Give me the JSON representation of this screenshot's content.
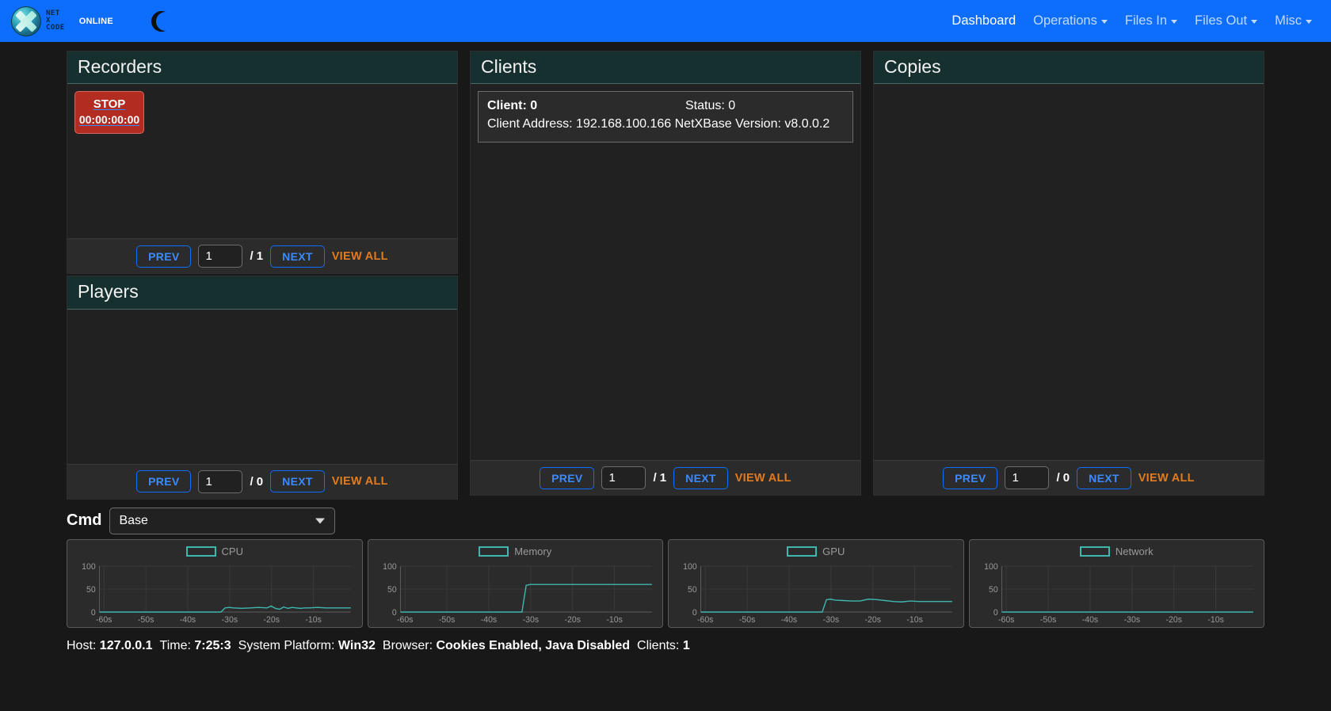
{
  "navbar": {
    "brand_lines": [
      "NET",
      "X",
      "CODE"
    ],
    "status_label": "ONLINE",
    "theme_toggle_icon": "moon-icon",
    "links": [
      {
        "label": "Dashboard",
        "has_caret": false,
        "active": true
      },
      {
        "label": "Operations",
        "has_caret": true,
        "active": false
      },
      {
        "label": "Files In",
        "has_caret": true,
        "active": false
      },
      {
        "label": "Files Out",
        "has_caret": true,
        "active": false
      },
      {
        "label": "Misc",
        "has_caret": true,
        "active": false
      }
    ],
    "brand_color": "#0d6efd"
  },
  "panels": {
    "recorders": {
      "title": "Recorders",
      "recorder": {
        "label": "STOP",
        "timecode": "00:00:00:00"
      },
      "pager": {
        "prev": "PREV",
        "page_value": "1",
        "separator": "/ 1",
        "next": "NEXT",
        "view_all": "VIEW ALL"
      }
    },
    "players": {
      "title": "Players",
      "pager": {
        "prev": "PREV",
        "page_value": "1",
        "separator": "/ 0",
        "next": "NEXT",
        "view_all": "VIEW ALL"
      }
    },
    "clients": {
      "title": "Clients",
      "card": {
        "client_label": "Client: 0",
        "status_label": "Status: 0",
        "address_line": "Client Address: 192.168.100.166 NetXBase Version: v8.0.0.2"
      },
      "pager": {
        "prev": "PREV",
        "page_value": "1",
        "separator": "/ 1",
        "next": "NEXT",
        "view_all": "VIEW ALL"
      }
    },
    "copies": {
      "title": "Copies",
      "pager": {
        "prev": "PREV",
        "page_value": "1",
        "separator": "/ 0",
        "next": "NEXT",
        "view_all": "VIEW ALL"
      }
    }
  },
  "cmd": {
    "label": "Cmd",
    "selected": "Base",
    "options": [
      "Base"
    ]
  },
  "chart_data": [
    {
      "type": "line",
      "title": "CPU",
      "xlabel": "",
      "ylabel": "",
      "ylim": [
        0,
        100
      ],
      "yticks": [
        0,
        50,
        100
      ],
      "xticks": [
        "-60s",
        "-50s",
        "-40s",
        "-30s",
        "-20s",
        "-10s"
      ],
      "grid": true,
      "legend_position": "top-center",
      "line_color": "#3fb6ae",
      "x": [
        -60,
        -58,
        -56,
        -54,
        -52,
        -50,
        -48,
        -46,
        -44,
        -42,
        -40,
        -38,
        -36,
        -34,
        -32,
        -31,
        -30,
        -29,
        -28,
        -26,
        -24,
        -22,
        -20,
        -19,
        -18,
        -17,
        -16,
        -15,
        -14,
        -13,
        -12,
        -11,
        -10,
        -8,
        -6,
        -4,
        -2,
        0
      ],
      "values": [
        0,
        0,
        0,
        0,
        0,
        0,
        0,
        0,
        0,
        0,
        0,
        0,
        0,
        0,
        0,
        0,
        9,
        10,
        9,
        8,
        9,
        10,
        9,
        13,
        8,
        6,
        11,
        8,
        10,
        9,
        8,
        9,
        9,
        10,
        9,
        9,
        9,
        9
      ]
    },
    {
      "type": "line",
      "title": "Memory",
      "xlabel": "",
      "ylabel": "",
      "ylim": [
        0,
        100
      ],
      "yticks": [
        0,
        50,
        100
      ],
      "xticks": [
        "-60s",
        "-50s",
        "-40s",
        "-30s",
        "-20s",
        "-10s"
      ],
      "grid": true,
      "legend_position": "top-center",
      "line_color": "#3fb6ae",
      "x": [
        -60,
        -56,
        -52,
        -48,
        -44,
        -40,
        -36,
        -34,
        -32,
        -31,
        -30,
        -29,
        -28,
        -26,
        -24,
        -20,
        -16,
        -12,
        -8,
        -4,
        0
      ],
      "values": [
        0,
        0,
        0,
        0,
        0,
        0,
        0,
        0,
        0,
        0,
        58,
        60,
        60,
        60,
        60,
        60,
        60,
        60,
        60,
        60,
        60
      ]
    },
    {
      "type": "line",
      "title": "GPU",
      "xlabel": "",
      "ylabel": "",
      "ylim": [
        0,
        100
      ],
      "yticks": [
        0,
        50,
        100
      ],
      "xticks": [
        "-60s",
        "-50s",
        "-40s",
        "-30s",
        "-20s",
        "-10s"
      ],
      "grid": true,
      "legend_position": "top-center",
      "line_color": "#3fb6ae",
      "x": [
        -60,
        -56,
        -52,
        -48,
        -44,
        -40,
        -36,
        -34,
        -32,
        -31,
        -30,
        -29,
        -28,
        -26,
        -24,
        -22,
        -20,
        -18,
        -16,
        -14,
        -12,
        -10,
        -8,
        -6,
        -4,
        -2,
        0
      ],
      "values": [
        0,
        0,
        0,
        0,
        0,
        0,
        0,
        0,
        0,
        0,
        27,
        28,
        26,
        25,
        24,
        24,
        28,
        27,
        25,
        23,
        22,
        24,
        23,
        23,
        23,
        23,
        23
      ]
    },
    {
      "type": "line",
      "title": "Network",
      "xlabel": "",
      "ylabel": "",
      "ylim": [
        0,
        100
      ],
      "yticks": [
        0,
        50,
        100
      ],
      "xticks": [
        "-60s",
        "-50s",
        "-40s",
        "-30s",
        "-20s",
        "-10s"
      ],
      "grid": true,
      "legend_position": "top-center",
      "line_color": "#3fb6ae",
      "x": [
        -60,
        -50,
        -40,
        -30,
        -20,
        -10,
        0
      ],
      "values": [
        0,
        0,
        0,
        0,
        0,
        0,
        0
      ]
    }
  ],
  "statusbar": {
    "items": [
      {
        "label": "Host:",
        "value": "127.0.0.1"
      },
      {
        "label": "Time:",
        "value": "7:25:3"
      },
      {
        "label": "System Platform:",
        "value": "Win32"
      },
      {
        "label": "Browser:",
        "value": "Cookies Enabled, Java Disabled"
      },
      {
        "label": "Clients:",
        "value": "1"
      }
    ]
  }
}
